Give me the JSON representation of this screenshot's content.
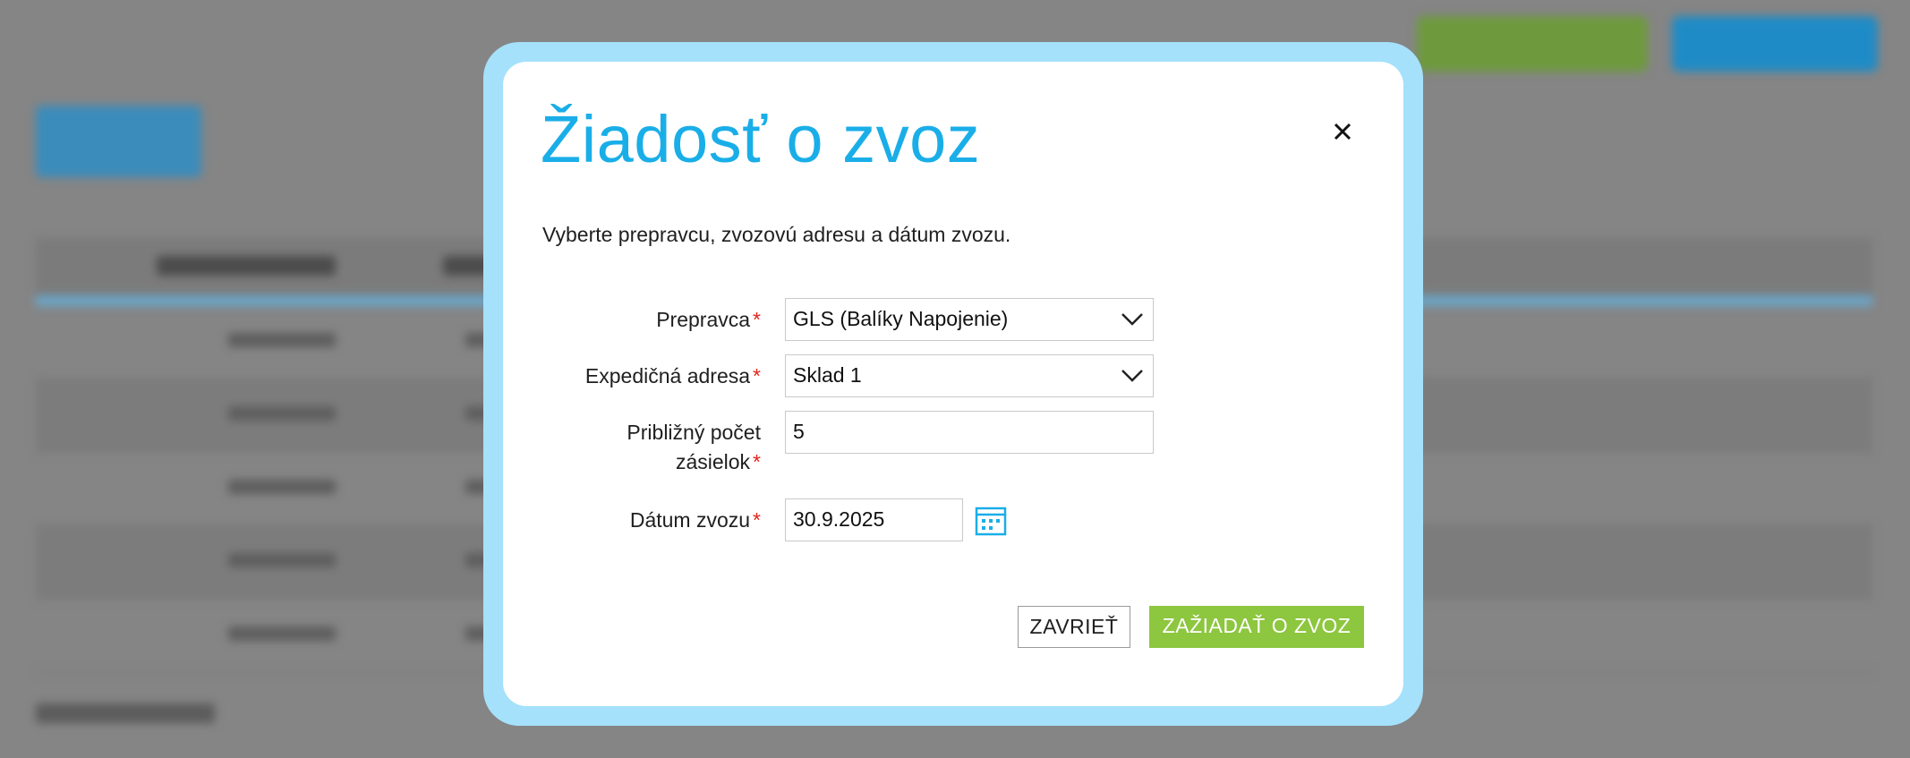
{
  "modal": {
    "title": "Žiadosť o zvoz",
    "intro": "Vyberte prepravcu, zvozovú adresu a dátum zvozu.",
    "required_mark": "*",
    "fields": {
      "carrier": {
        "label": "Prepravca",
        "value": "GLS (Balíky Napojenie)"
      },
      "address": {
        "label": "Expedičná adresa",
        "value": "Sklad 1"
      },
      "count": {
        "label_line1": "Približný počet",
        "label_line2": "zásielok",
        "value": "5"
      },
      "date": {
        "label": "Dátum zvozu",
        "value": "30.9.2025"
      }
    },
    "buttons": {
      "close": "ZAVRIEŤ",
      "submit": "ZAŽIADAŤ O ZVOZ"
    }
  },
  "colors": {
    "title": "#1aaee8",
    "frame": "#a5e1fb",
    "submit": "#8dc63f",
    "required": "#e2231a"
  },
  "icons": [
    "close-icon",
    "chevron-down-icon",
    "calendar-icon"
  ]
}
